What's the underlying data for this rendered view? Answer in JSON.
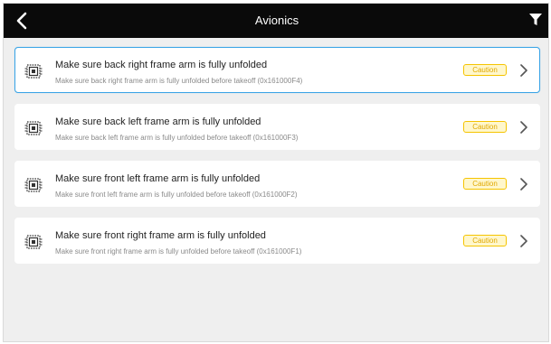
{
  "header": {
    "title": "Avionics",
    "back_icon": "chevron-left-icon",
    "filter_icon": "filter-icon",
    "background": "#0a0a0a"
  },
  "items": [
    {
      "title": "Make sure back right frame arm is fully unfolded",
      "description": "Make sure back right frame arm is fully unfolded before takeoff (0x161000F4)",
      "badge": "Caution",
      "selected": true
    },
    {
      "title": "Make sure back left frame arm is fully unfolded",
      "description": "Make sure back left frame arm is fully unfolded before takeoff (0x161000F3)",
      "badge": "Caution",
      "selected": false
    },
    {
      "title": "Make sure front left frame arm is fully unfolded",
      "description": "Make sure front left frame arm is fully unfolded before takeoff (0x161000F2)",
      "badge": "Caution",
      "selected": false
    },
    {
      "title": "Make sure front right frame arm is fully unfolded",
      "description": "Make sure front right frame arm is fully unfolded before takeoff (0x161000F1)",
      "badge": "Caution",
      "selected": false
    }
  ],
  "colors": {
    "accent": "#3aa4e6",
    "caution_text": "#e0a800",
    "caution_border": "#f5c400",
    "caution_bg": "#fff7cc"
  }
}
